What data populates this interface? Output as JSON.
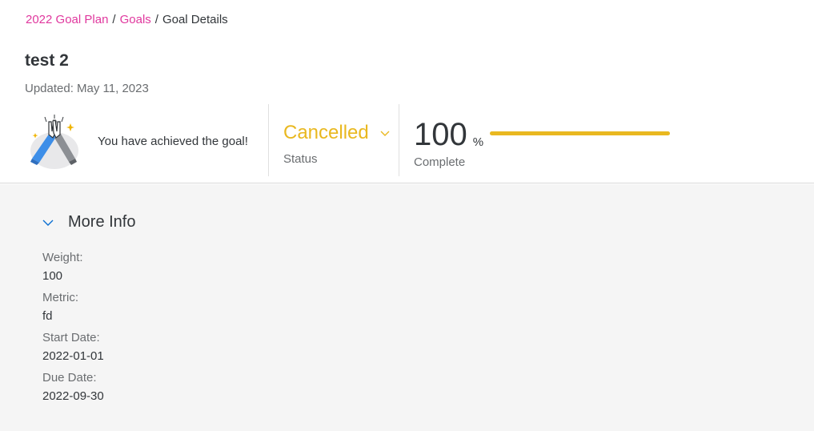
{
  "breadcrumb": {
    "items": [
      "2022 Goal Plan",
      "Goals"
    ],
    "separator": "/",
    "current": "Goal Details"
  },
  "goal": {
    "title": "test 2",
    "updated": "Updated: May 11, 2023"
  },
  "achievement": {
    "icon": "high-five-icon",
    "text": "You have achieved the goal!"
  },
  "status": {
    "value": "Cancelled",
    "label": "Status",
    "color": "#e9b820"
  },
  "completion": {
    "value": "100",
    "unit": "%",
    "label": "Complete",
    "progress_percent": 100,
    "color": "#e9b820"
  },
  "more_info": {
    "title": "More Info",
    "fields": [
      {
        "label": "Weight:",
        "value": "100"
      },
      {
        "label": "Metric:",
        "value": "fd"
      },
      {
        "label": "Start Date:",
        "value": "2022-01-01"
      },
      {
        "label": "Due Date:",
        "value": "2022-09-30"
      }
    ]
  },
  "colors": {
    "link": "#e0389e",
    "accent": "#e9b820",
    "content_bg": "#f5f5f5"
  }
}
